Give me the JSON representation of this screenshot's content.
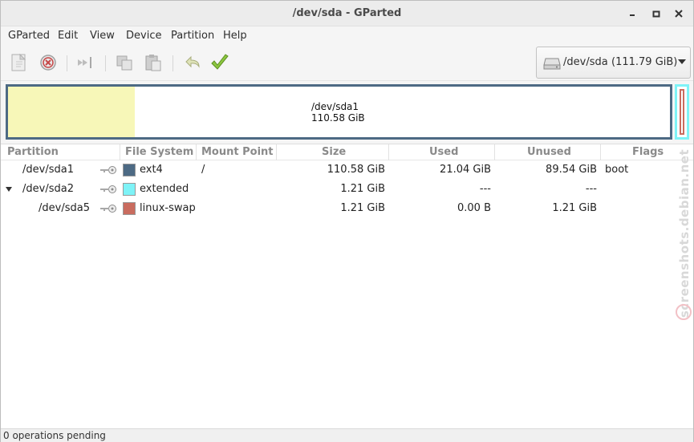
{
  "window": {
    "title": "/dev/sda - GParted",
    "min": "▪",
    "max": "▫",
    "close": "✕"
  },
  "menu": [
    "GParted",
    "Edit",
    "View",
    "Device",
    "Partition",
    "Help"
  ],
  "toolbar": {
    "icons": [
      "new-partition-icon",
      "delete-partition-icon",
      "resize-move-icon",
      "copy-icon",
      "paste-icon",
      "undo-icon",
      "apply-icon"
    ]
  },
  "device_selector": {
    "device": "/dev/sda",
    "size": "(111.79 GiB)",
    "icon": "harddisk-icon"
  },
  "disk_map": {
    "label_name": "/dev/sda1",
    "label_size": "110.58 GiB",
    "used_fraction": 0.19,
    "colors": {
      "border": "#4d6a84",
      "used": "#f7f7b8",
      "extended": "#7ef3f7",
      "swap": "#c96c5f"
    }
  },
  "table": {
    "headers": [
      "Partition",
      "File System",
      "Mount Point",
      "Size",
      "Used",
      "Unused",
      "Flags"
    ],
    "rows": [
      {
        "partition": "/dev/sda1",
        "filesystem": "ext4",
        "fs_color": "#4d6a84",
        "mount": "/",
        "size": "110.58 GiB",
        "used": "21.04 GiB",
        "unused": "89.54 GiB",
        "flags": "boot",
        "expander": false
      },
      {
        "partition": "/dev/sda2",
        "filesystem": "extended",
        "fs_color": "#7ef3f7",
        "mount": "",
        "size": "1.21 GiB",
        "used": "---",
        "unused": "---",
        "flags": "",
        "expander": true
      },
      {
        "partition": "/dev/sda5",
        "filesystem": "linux-swap",
        "fs_color": "#c96c5f",
        "mount": "",
        "size": "1.21 GiB",
        "used": "0.00 B",
        "unused": "1.21 GiB",
        "flags": "",
        "expander": false
      }
    ]
  },
  "watermark": "screenshots.debian.net",
  "status": "0 operations pending"
}
